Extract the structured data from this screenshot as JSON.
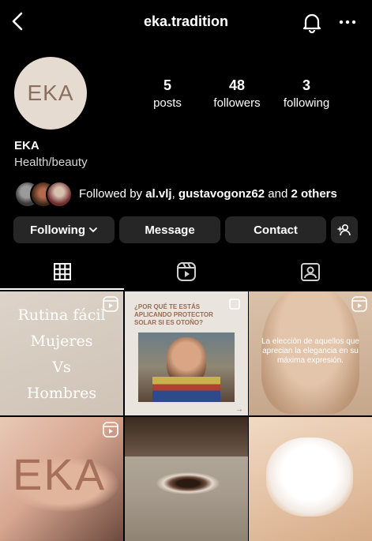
{
  "header": {
    "username": "eka.tradition"
  },
  "profile": {
    "avatar_text": "EKA",
    "name": "EKA",
    "category": "Health/beauty"
  },
  "stats": [
    {
      "value": "5",
      "label": "posts"
    },
    {
      "value": "48",
      "label": "followers"
    },
    {
      "value": "3",
      "label": "following"
    }
  ],
  "followed_by": {
    "prefix": "Followed by ",
    "user1": "al.vlj",
    "separator": ", ",
    "user2": "gustavogonz62",
    "middle": " and ",
    "others": "2 others"
  },
  "buttons": {
    "following": "Following",
    "message": "Message",
    "contact": "Contact"
  },
  "tabs": [
    "grid-icon",
    "reels-icon",
    "tagged-icon"
  ],
  "posts": {
    "p1": {
      "lines": [
        "Rutina fácil",
        "Mujeres",
        "Vs",
        "Hombres"
      ]
    },
    "p2": {
      "headline": "¿POR QUÉ TE ESTÁS APLICANDO PROTECTOR SOLAR SI ES OTOÑO?"
    },
    "p3": {
      "text": "La elección de aquellos que aprecian la elegancia en su máxima expresión."
    },
    "p4": {
      "logo": "EKA"
    }
  },
  "colors": {
    "background": "#000000",
    "button": "#262626",
    "avatar_bg": "#e6dbd1",
    "brand": "#8b6e5d"
  }
}
